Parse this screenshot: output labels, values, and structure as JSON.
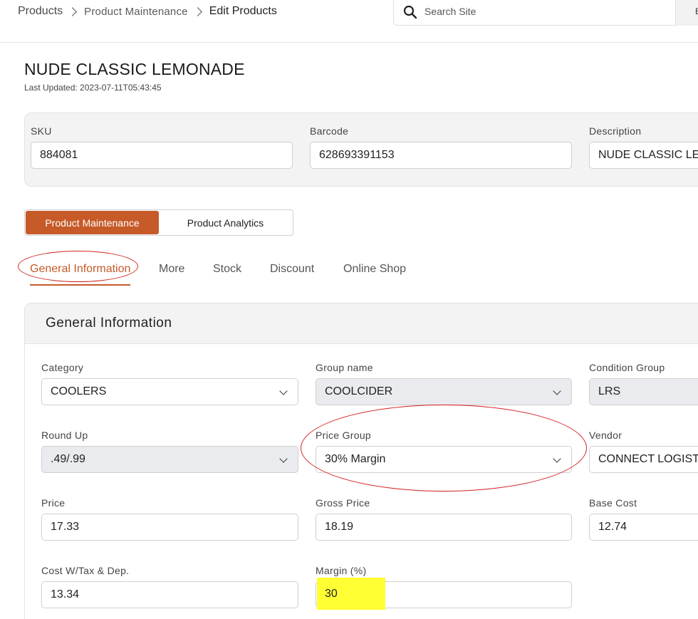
{
  "breadcrumb": [
    "Products",
    "Product Maintenance",
    "Edit Products"
  ],
  "search": {
    "placeholder": "Search Site",
    "button": "E"
  },
  "product": {
    "title": "NUDE CLASSIC LEMONADE",
    "last_updated": "Last Updated: 2023-07-11T05:43:45"
  },
  "header_fields": {
    "sku": {
      "label": "SKU",
      "value": "884081"
    },
    "barcode": {
      "label": "Barcode",
      "value": "628693391153"
    },
    "description": {
      "label": "Description",
      "value": "NUDE CLASSIC LEMONADE"
    }
  },
  "toggle": {
    "active": "Product Maintenance",
    "other": "Product Analytics"
  },
  "tabs": [
    "General Information",
    "More",
    "Stock",
    "Discount",
    "Online Shop"
  ],
  "section_title": "General Information",
  "fields": {
    "category": {
      "label": "Category",
      "value": "COOLERS"
    },
    "group_name": {
      "label": "Group name",
      "value": "COOLCIDER"
    },
    "condition_group": {
      "label": "Condition Group",
      "value": "LRS"
    },
    "round_up": {
      "label": "Round Up",
      "value": ".49/.99"
    },
    "price_group": {
      "label": "Price Group",
      "value": "30% Margin"
    },
    "vendor": {
      "label": "Vendor",
      "value": "CONNECT LOGISTICS"
    },
    "price": {
      "label": "Price",
      "value": "17.33"
    },
    "gross_price": {
      "label": "Gross Price",
      "value": "18.19"
    },
    "base_cost": {
      "label": "Base Cost",
      "value": "12.74"
    },
    "cost_tax_dep": {
      "label": "Cost W/Tax & Dep.",
      "value": "13.34"
    },
    "margin": {
      "label": "Margin (%)",
      "value": "30"
    }
  },
  "colors": {
    "accent": "#c65a28",
    "annotation": "#d42020",
    "highlight": "#ffff33"
  }
}
